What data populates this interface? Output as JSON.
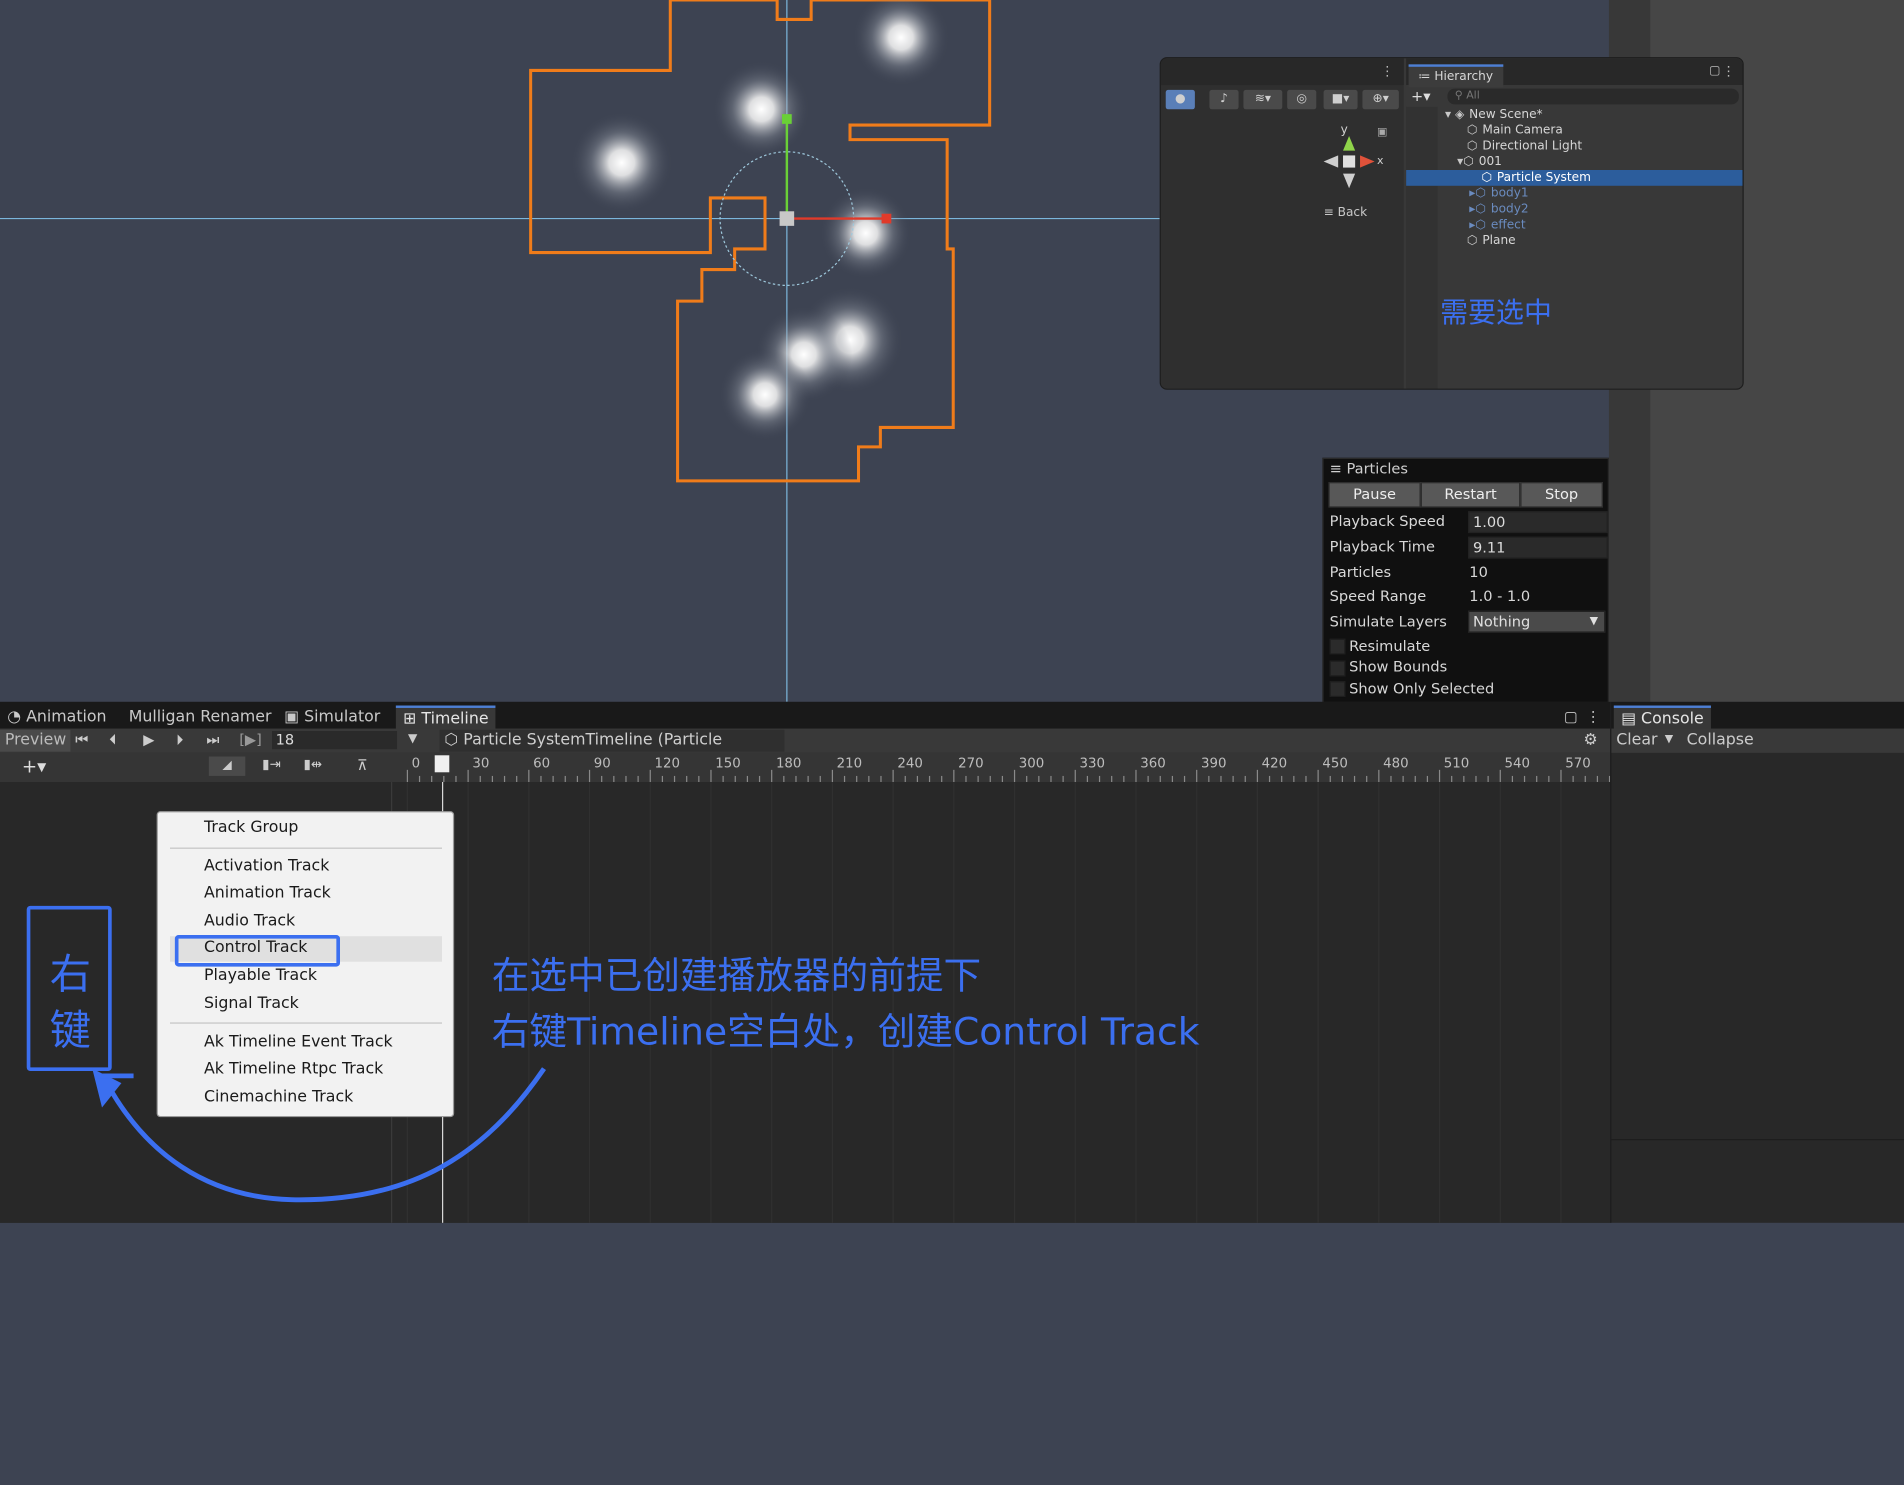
{
  "hierarchy": {
    "tab_label": "Hierarchy",
    "search_placeholder": "All",
    "items": [
      "New Scene*",
      "Main Camera",
      "Directional Light",
      "001",
      "Particle System",
      "body1",
      "body2",
      "effect",
      "Plane"
    ],
    "back_label": "Back",
    "gizmo_y": "y",
    "gizmo_x": "x"
  },
  "annotations": {
    "need_select": "需要选中",
    "right_click": [
      "右",
      "键"
    ],
    "instruction_line1": "在选中已创建播放器的前提下",
    "instruction_line2": "右键Timeline空白处，创建Control Track",
    "accent_color": "#3b6ff0"
  },
  "particles": {
    "title": "Particles",
    "buttons": [
      "Pause",
      "Restart",
      "Stop"
    ],
    "playback_speed_label": "Playback Speed",
    "playback_speed": "1.00",
    "playback_time_label": "Playback Time",
    "playback_time": "9.11",
    "particles_label": "Particles",
    "particles_count": "10",
    "speed_range_label": "Speed Range",
    "speed_range": "1.0 - 1.0",
    "simulate_layers_label": "Simulate Layers",
    "simulate_layers": "Nothing",
    "checkboxes": [
      "Resimulate",
      "Show Bounds",
      "Show Only Selected"
    ]
  },
  "bottom_tabs": [
    "Animation",
    "Mulligan Renamer",
    "Simulator",
    "Timeline"
  ],
  "timeline": {
    "preview_label": "Preview",
    "frame_value": "18",
    "asset_label": "Particle SystemTimeline (Particle System)",
    "ruler_ticks": [
      "0",
      "30",
      "60",
      "90",
      "120",
      "150",
      "180",
      "210",
      "240",
      "270",
      "300",
      "330",
      "360",
      "390",
      "420",
      "450",
      "480",
      "510",
      "540",
      "570"
    ]
  },
  "console": {
    "tab_label": "Console",
    "clear_label": "Clear",
    "collapse_label": "Collapse"
  },
  "context_menu": {
    "items": [
      "Track Group",
      "Activation Track",
      "Animation Track",
      "Audio Track",
      "Control Track",
      "Playable Track",
      "Signal Track",
      "Ak Timeline Event Track",
      "Ak Timeline Rtpc Track",
      "Cinemachine Track"
    ]
  }
}
